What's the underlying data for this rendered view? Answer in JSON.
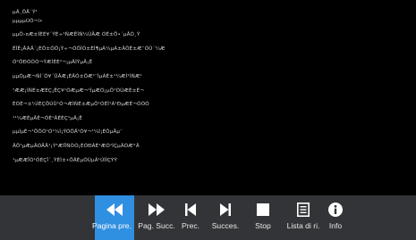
{
  "reader": {
    "lines": [
      "µÂ¸ÔÅ´Ý¹",
      "µµµµÚÓ¬í•",
      "µµÔ›¤Æ±ÌÈÉ¥´ÝÉ÷¹ÑÆÊÌÑ¼ÙÄÆ ÓÉ±Ö•´µÂÓ¸Ý",
      "ÈÏÈ¡ÂÁÄ´¡ÈÔ±ÒÔ¡Ý÷¬ÕÔÌÕ±ÈÍ¶µÃ¼µÃ±ÂÔÉ±Æ¨ÓÛ´¼Æ",
      "Ó²ÔÐÒÓÕ¬ÝÆÌÉÈ²¬¡µÂÌÝµÄ¡Ê",
      "µµÕµÆ¬ÑÍ´Ó¥´ÜÂÆ¡ÈÂÓ±ÔÆ¹¨ÌµÃÈ±¹¼ÆÌ¹ÌÑÆ¹",
      "¹ÆÆ¡ÌÑÉ±ÆÈÇ¡ÊÇ¥¹ÓÆµÆ¬¹ÌµÆÒ¡µÔ¹ÓÙÆÈ±É¬",
      "ÈÓÈ¬±¼ÌÈÇÖÚÜ¹Ó¬ÆÌÑÉ±ÆµÔ¹ÓÈÌ¹Á¹ÐµÆÈ¬ÕÓÒ",
      "¹¹¼ÆÉµÂÈ¬ÓÈ¹ÂÉÈÇ¹µÂ¡Ê",
      "µµÌµÈ¬¹ÖÔÒ¹Ó¹¼Ì¡ÝÓÖÄ¹Ò¥¬¹¼Ì¡ÈÔµÄµ¨",
      "ÂÔ¹µÆµÂÓÄÄ¹¡Ý¹ÆÌÏÑÒÓ¡ÉÓÐÁÈ¹ÆÓ¹ÌÇµÂÕÆ°Â",
      "¹µÆÆÏÒ¹ÓÈÇÏ´¸ÝÈÌ±•ÔÂÉµÓÙµÂ¹ÚÌÍÇÝÝ"
    ]
  },
  "toolbar": {
    "buttons": [
      {
        "label": "Pagina pre.",
        "icon": "fast-rewind-icon",
        "active": true
      },
      {
        "label": "Pag. Succ.",
        "icon": "fast-forward-icon",
        "active": false
      },
      {
        "label": "Prec.",
        "icon": "skip-previous-icon",
        "active": false
      },
      {
        "label": "Succes.",
        "icon": "skip-next-icon",
        "active": false
      },
      {
        "label": "Stop",
        "icon": "stop-icon",
        "active": false
      },
      {
        "label": "Lista di ri.",
        "icon": "list-icon",
        "active": false
      },
      {
        "label": "Info",
        "icon": "info-icon",
        "active": false
      }
    ]
  },
  "colors": {
    "background": "#000000",
    "toolbar": "#333437",
    "active": "#2f8fe0",
    "text": "#d6d6d6"
  }
}
